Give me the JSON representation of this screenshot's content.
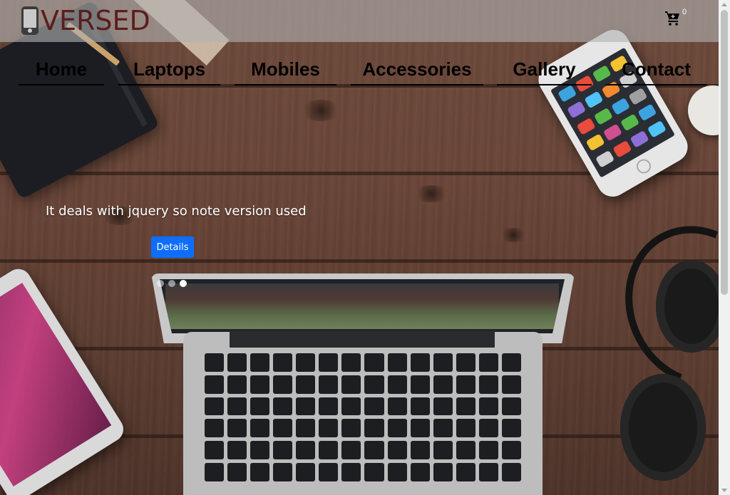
{
  "brand": {
    "logo_text": "VERSED",
    "logo_icon": "phone-icon",
    "logo_color": "#5a1d1d"
  },
  "cart": {
    "icon": "cart-plus-icon",
    "count": "0"
  },
  "nav": {
    "items": [
      {
        "label": "Home"
      },
      {
        "label": "Laptops"
      },
      {
        "label": "Mobiles"
      },
      {
        "label": "Accessories"
      },
      {
        "label": "Gallery"
      },
      {
        "label": "Contact"
      }
    ]
  },
  "hero": {
    "caption": "It deals with jquery so note version used",
    "button_label": "Details",
    "button_color": "#0d6efd",
    "slides": 3,
    "active_slide": 3
  },
  "colors": {
    "topbar": "#b2b2b2",
    "nav_text": "#000000"
  }
}
